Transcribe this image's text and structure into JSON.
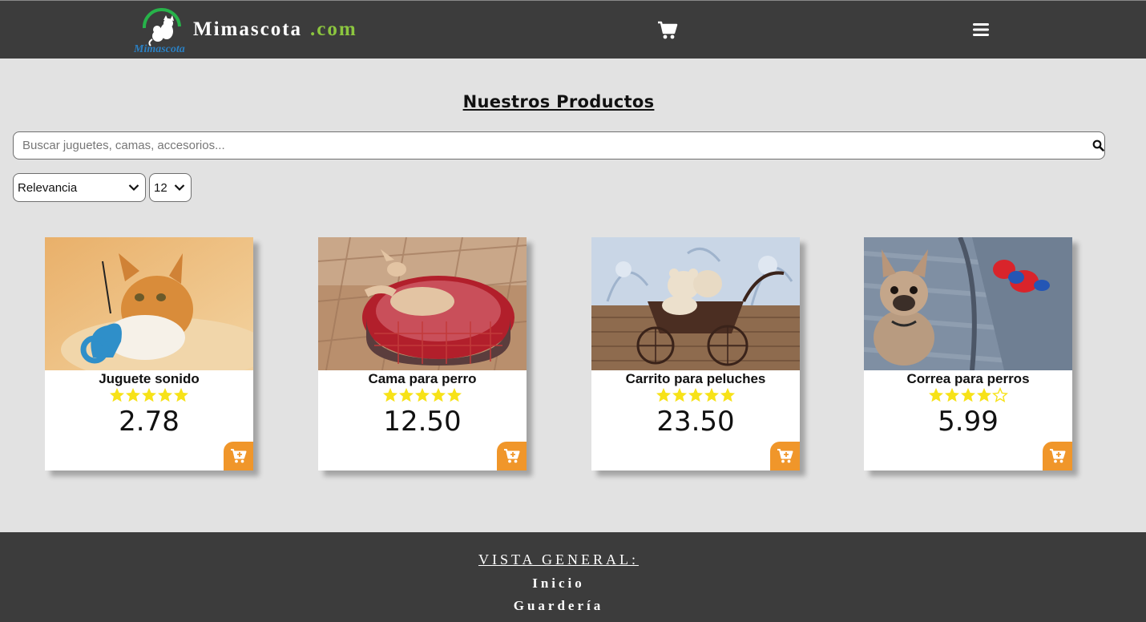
{
  "header": {
    "brand_name": "Mimascota",
    "brand_tld": ".com",
    "logo_text": "Mimascota",
    "cart_icon": "shopping-cart-icon",
    "menu_icon": "hamburger-menu-icon"
  },
  "main": {
    "title": "Nuestros Productos",
    "search": {
      "placeholder": "Buscar juguetes, camas, accesorios...",
      "value": "",
      "icon": "search-icon"
    },
    "sort": {
      "selected": "Relevancia"
    },
    "per_page": {
      "selected": "12"
    }
  },
  "products": [
    {
      "name": "Juguete sonido",
      "price": "2.78",
      "rating": 5,
      "image": "cat-with-toy"
    },
    {
      "name": "Cama para perro",
      "price": "12.50",
      "rating": 5,
      "image": "dog-in-bed"
    },
    {
      "name": "Carrito para peluches",
      "price": "23.50",
      "rating": 5,
      "image": "toy-stroller"
    },
    {
      "name": "Correa para perros",
      "price": "5.99",
      "rating": 4,
      "image": "french-bulldog"
    }
  ],
  "footer": {
    "title": "VISTA GENERAL:",
    "links": [
      "Inicio",
      "Guardería"
    ]
  },
  "colors": {
    "header_bg": "#3c3c3c",
    "page_bg": "#e2e2e2",
    "accent_green": "#8cc63f",
    "cart_button": "#f0962a",
    "star": "#f7e218"
  }
}
